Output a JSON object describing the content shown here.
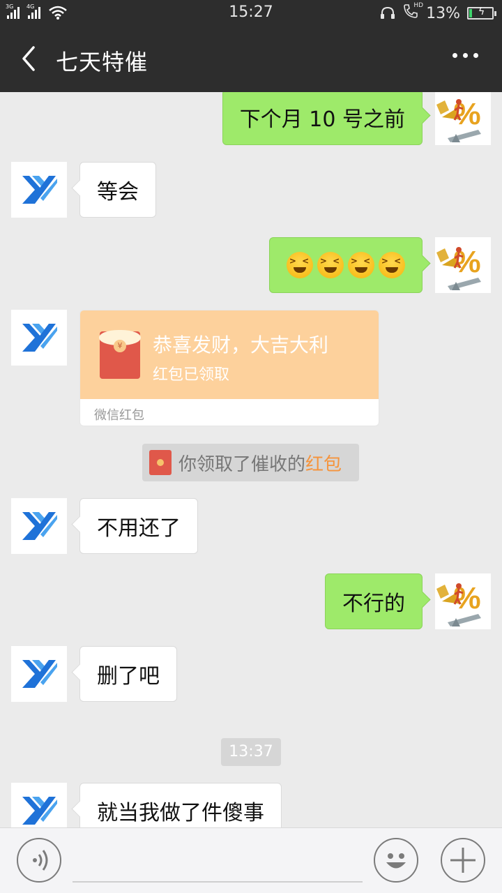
{
  "status_bar": {
    "net1": "3G",
    "net2": "4G",
    "time": "15:27",
    "hd_label": "HD",
    "battery": "13%",
    "battery_level": 0.13,
    "icons": [
      "signal-icon",
      "wifi-icon",
      "headset-icon",
      "hd-call-icon",
      "battery-icon"
    ]
  },
  "header": {
    "title": "七天特催",
    "back_icon": "chevron-left-icon",
    "more_icon": "more-dots-icon"
  },
  "messages": {
    "m1": "下个月 10 号之前",
    "m2": "等会",
    "m3_emoji_count": 4,
    "m3_emoji": "crying-face-emoji",
    "m5": "不用还了",
    "m6": "不行的",
    "m7": "删了吧",
    "m8": "就当我做了件傻事"
  },
  "red_packet": {
    "wish": "恭喜发财，大吉大利",
    "status": "红包已领取",
    "footer": "微信红包"
  },
  "notice": {
    "prefix": "你领取了催收的",
    "highlight": "红包"
  },
  "timestamp": "13:37",
  "colors": {
    "bar": "#2d2d2d",
    "out_bubble": "#9eea6a",
    "in_bubble": "#ffffff",
    "chat_bg": "#ebebeb",
    "red_packet": "#fdd19c",
    "highlight": "#f5943d",
    "logo_blue": "#1f72d8"
  },
  "input_bar": {
    "voice_icon": "voice-icon",
    "emoji_icon": "smiley-icon",
    "plus_icon": "plus-icon"
  }
}
